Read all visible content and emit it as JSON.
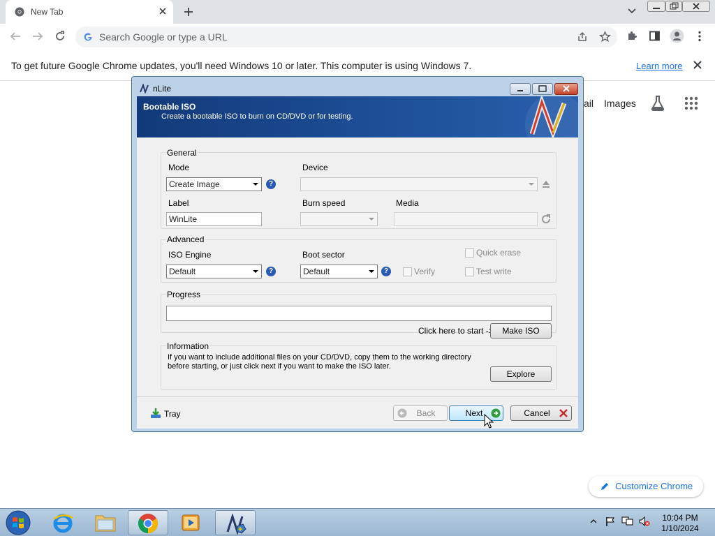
{
  "browser": {
    "tab_title": "New Tab",
    "omnibox_placeholder": "Search Google or type a URL",
    "infobar_text": "To get future Google Chrome updates, you'll need Windows 10 or later. This computer is using Windows 7.",
    "infobar_link": "Learn more",
    "google_links": {
      "gmail_partial": "ail",
      "images": "Images"
    },
    "customize_label": "Customize Chrome"
  },
  "nlite": {
    "window_title": "nLite",
    "header_title": "Bootable ISO",
    "header_subtitle": "Create a bootable ISO to burn on CD/DVD or for testing.",
    "general": {
      "group_label": "General",
      "mode_label": "Mode",
      "mode_value": "Create Image",
      "device_label": "Device",
      "device_value": "",
      "label_label": "Label",
      "label_value": "WinLite",
      "burn_speed_label": "Burn speed",
      "media_label": "Media"
    },
    "advanced": {
      "group_label": "Advanced",
      "iso_engine_label": "ISO Engine",
      "iso_engine_value": "Default",
      "boot_sector_label": "Boot sector",
      "boot_sector_value": "Default",
      "verify_label": "Verify",
      "quick_erase_label": "Quick erase",
      "test_write_label": "Test write"
    },
    "progress": {
      "group_label": "Progress",
      "start_hint": "Click here to start ->",
      "make_iso_label": "Make ISO",
      "value": 0
    },
    "information": {
      "group_label": "Information",
      "line1": "If you want to include additional files on your CD/DVD, copy them to the working directory",
      "line2": "before starting, or just click next if you want to make the ISO later.",
      "explore_label": "Explore"
    },
    "footer": {
      "tray_label": "Tray",
      "back_label": "Back",
      "next_label": "Next",
      "cancel_label": "Cancel"
    }
  },
  "taskbar": {
    "time": "10:04 PM",
    "date": "1/10/2024"
  },
  "colors": {
    "nlite_header": "#1f5099",
    "chrome_link": "#1a73e8",
    "help_icon": "#2a5ab3"
  }
}
